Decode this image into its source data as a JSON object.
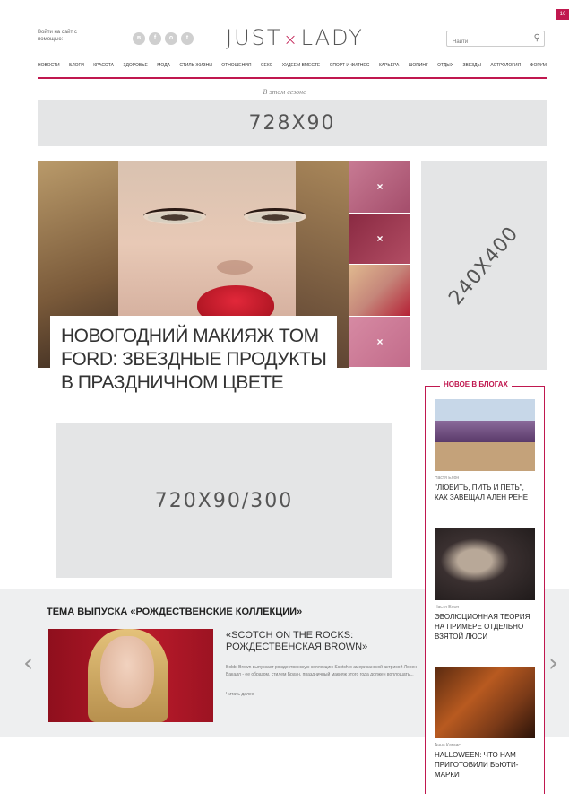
{
  "header": {
    "login_text": "Войти на сайт с помощью:",
    "socials": [
      "vk",
      "fb",
      "ok",
      "tw"
    ],
    "logo_left": "JUST",
    "logo_sep": "×",
    "logo_right": "LADY",
    "search_placeholder": "Найти"
  },
  "corner_badge": "16",
  "nav": [
    "Новости",
    "Блоги",
    "Красота",
    "Здоровье",
    "Мода",
    "Стиль жизни",
    "Отношения",
    "Секс",
    "Худеем вместе",
    "Спорт и фитнес",
    "Карьера",
    "Шопинг",
    "Отдых",
    "Звезды",
    "Астрология",
    "Форум"
  ],
  "season_label": "В этом сезоне",
  "ads": {
    "top": "728X90",
    "side": "240X400",
    "middle": "720X90/300"
  },
  "hero": {
    "title": "Новогодний макияж Tom Ford: звездные продукты в праздничном цвете",
    "thumb_close": "×"
  },
  "theme": {
    "title": "Тема выпуска «Рождественские коллекции»",
    "prev": "‹",
    "next": "›",
    "feature_title": "«Scotch on the rocks: рождественская Brown»",
    "feature_text": "Bobbi Brown выпускает рождественскую коллекцию Scotch o американской актрисой Лорен Бакалл - ее образом, стилем Браун, праздничный макияж этого года должен воплощать...",
    "read_more": "Читать далее"
  },
  "blogs": {
    "title": "Новое в блогах",
    "items": [
      {
        "author": "Настя Елон",
        "title": "\"Любить, пить и петь\", как завещал Ален Рене"
      },
      {
        "author": "Настя Елон",
        "title": "Эволюционная теория на примере отдельно взятой Люси"
      },
      {
        "author": "Анна Катаис",
        "title": "Halloween: что нам приготовили бьюти-марки"
      }
    ]
  },
  "colors": {
    "accent": "#c0184f",
    "ad_bg": "#e4e5e6"
  }
}
